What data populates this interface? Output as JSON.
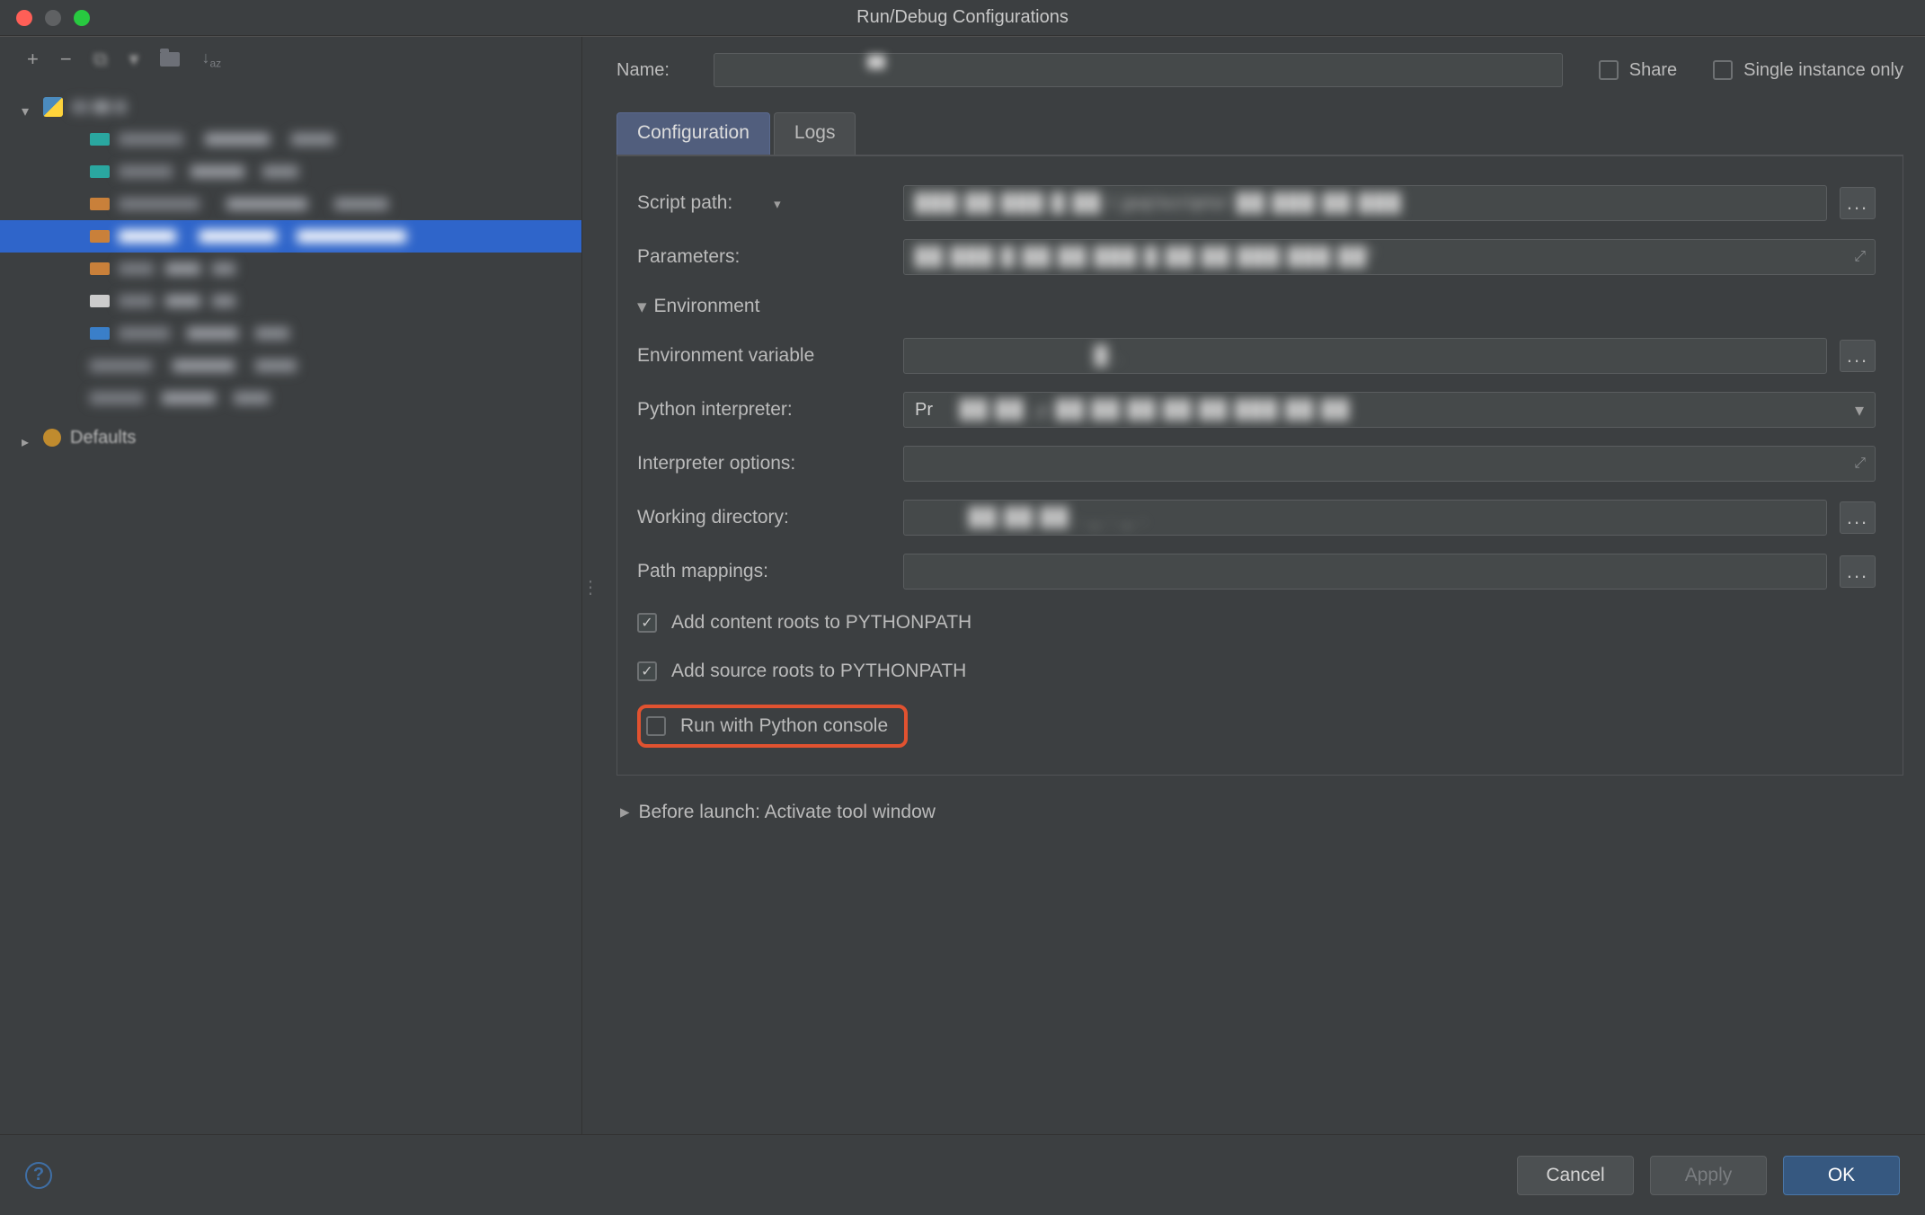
{
  "window": {
    "title": "Run/Debug Configurations"
  },
  "sidebar": {
    "toolbar_icons": {
      "add": "+",
      "remove": "−",
      "copy": "⧉",
      "save": "↓",
      "folder": "folder",
      "sort": "↓a z"
    },
    "python_group": "",
    "defaults_label": "Defaults",
    "items": [
      {
        "redacted": true
      },
      {
        "redacted": true
      },
      {
        "redacted": true
      },
      {
        "redacted": true,
        "selected": true
      },
      {
        "redacted": true
      },
      {
        "redacted": true
      },
      {
        "redacted": true
      },
      {
        "redacted": true
      },
      {
        "redacted": true
      }
    ]
  },
  "form": {
    "name_label": "Name:",
    "share_label": "Share",
    "single_instance_label": "Single instance only",
    "tabs": {
      "configuration": "Configuration",
      "logs": "Logs"
    },
    "script_path_label": "Script path:",
    "parameters_label": "Parameters:",
    "environment_section": "Environment",
    "env_vars_label": "Environment variable",
    "interpreter_label": "Python interpreter:",
    "interpreter_prefix": "Pr",
    "interp_options_label": "Interpreter options:",
    "working_dir_label": "Working directory:",
    "path_mappings_label": "Path mappings:",
    "add_content_roots": "Add content roots to PYTHONPATH",
    "add_source_roots": "Add source roots to PYTHONPATH",
    "run_with_console": "Run with Python console",
    "before_launch": "Before launch: Activate tool window"
  },
  "footer": {
    "cancel": "Cancel",
    "apply": "Apply",
    "ok": "OK"
  }
}
